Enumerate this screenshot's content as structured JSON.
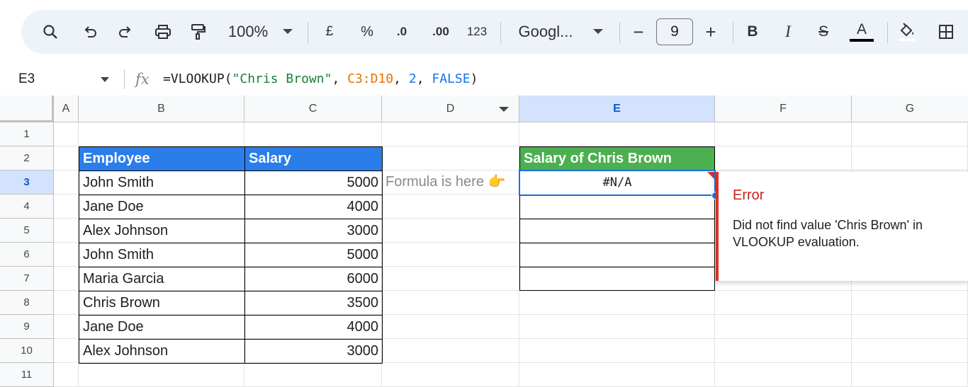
{
  "toolbar": {
    "zoom": "100%",
    "currency": "£",
    "percent": "%",
    "dec_decrease": ".0",
    "dec_increase": ".00",
    "more_formats": "123",
    "font": "Googl...",
    "font_size": "9",
    "minus": "−",
    "plus": "+",
    "bold": "B",
    "italic": "I",
    "strike": "S",
    "text_color": "A"
  },
  "formula_bar": {
    "name_box": "E3",
    "fx": "fx",
    "formula_prefix": "=VLOOKUP(",
    "formula_string": "\"Chris Brown\"",
    "formula_comma1": ", ",
    "formula_range": "C3:D10",
    "formula_comma2": ", ",
    "formula_index": "2",
    "formula_comma3": ", ",
    "formula_bool": "FALSE",
    "formula_suffix": ")"
  },
  "columns": [
    "A",
    "B",
    "C",
    "D",
    "E",
    "F",
    "G"
  ],
  "rows": [
    "1",
    "2",
    "3",
    "4",
    "5",
    "6",
    "7",
    "8",
    "9",
    "10",
    "11"
  ],
  "table": {
    "header_employee": "Employee",
    "header_salary": "Salary",
    "employees": [
      "John Smith",
      "Jane Doe",
      "Alex Johnson",
      "John Smith",
      "Maria Garcia",
      "Chris Brown",
      "Jane Doe",
      "Alex Johnson"
    ],
    "salaries": [
      "5000",
      "4000",
      "3000",
      "5000",
      "6000",
      "3500",
      "4000",
      "3000"
    ]
  },
  "note": "Formula is here 👉",
  "result": {
    "header": "Salary of Chris Brown",
    "value": "#N/A"
  },
  "error_tooltip": {
    "title": "Error",
    "message": "Did not find value 'Chris Brown' in VLOOKUP evaluation."
  },
  "colors": {
    "header_blue": "#2b7de9",
    "header_green": "#4caf50",
    "selection": "#1a73e8",
    "error": "#d93025"
  }
}
